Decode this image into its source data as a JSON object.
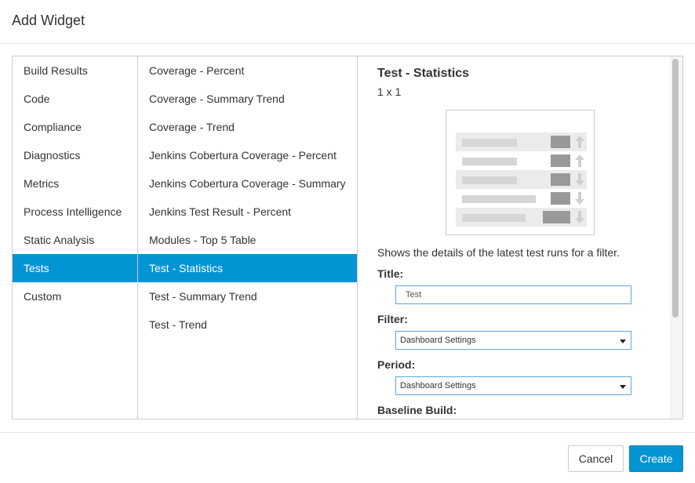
{
  "dialog": {
    "title": "Add Widget"
  },
  "categories": [
    {
      "label": "Build Results",
      "selected": false
    },
    {
      "label": "Code",
      "selected": false
    },
    {
      "label": "Compliance",
      "selected": false
    },
    {
      "label": "Diagnostics",
      "selected": false
    },
    {
      "label": "Metrics",
      "selected": false
    },
    {
      "label": "Process Intelligence",
      "selected": false
    },
    {
      "label": "Static Analysis",
      "selected": false
    },
    {
      "label": "Tests",
      "selected": true
    },
    {
      "label": "Custom",
      "selected": false
    }
  ],
  "widgets": [
    {
      "label": "Coverage - Percent",
      "selected": false
    },
    {
      "label": "Coverage - Summary Trend",
      "selected": false
    },
    {
      "label": "Coverage - Trend",
      "selected": false
    },
    {
      "label": "Jenkins Cobertura Coverage - Percent",
      "selected": false
    },
    {
      "label": "Jenkins Cobertura Coverage - Summary",
      "selected": false
    },
    {
      "label": "Jenkins Test Result - Percent",
      "selected": false
    },
    {
      "label": "Modules - Top 5 Table",
      "selected": false
    },
    {
      "label": "Test - Statistics",
      "selected": true
    },
    {
      "label": "Test - Summary Trend",
      "selected": false
    },
    {
      "label": "Test - Trend",
      "selected": false
    }
  ],
  "detail": {
    "title": "Test - Statistics",
    "size": "1 x 1",
    "description": "Shows the details of the latest test runs for a filter.",
    "preview_icons": [
      "arrow-up-icon",
      "arrow-up-icon",
      "arrow-down-icon",
      "arrow-down-icon",
      "arrow-down-icon"
    ],
    "fields": {
      "title_label": "Title:",
      "title_value": "Test",
      "filter_label": "Filter:",
      "filter_value": "Dashboard Settings",
      "period_label": "Period:",
      "period_value": "Dashboard Settings",
      "baseline_label": "Baseline Build:"
    }
  },
  "footer": {
    "cancel_label": "Cancel",
    "create_label": "Create"
  },
  "colors": {
    "accent": "#0394d3",
    "border": "#cccccc",
    "input_border": "#5aa9d6"
  }
}
